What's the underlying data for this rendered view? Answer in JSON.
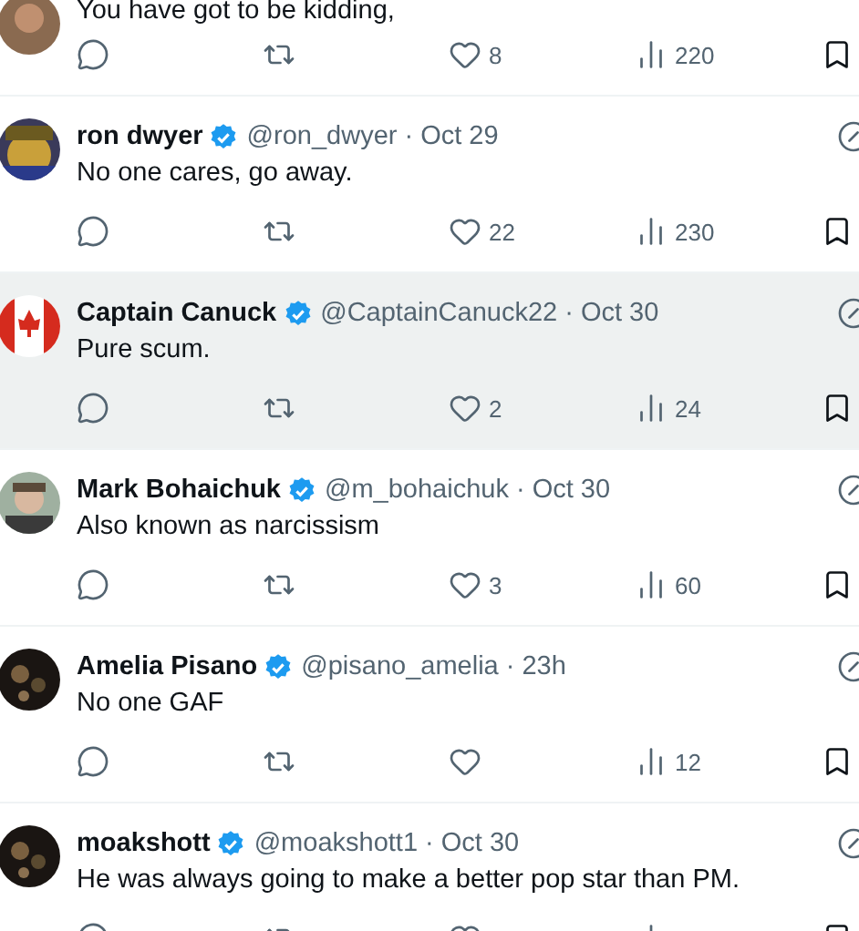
{
  "tweets": [
    {
      "text": "You have got to be kidding,",
      "highlighted": false,
      "likes": "8",
      "views": "220"
    },
    {
      "name": "ron dwyer",
      "handle": "@ron_dwyer",
      "separator": "·",
      "time": "Oct 29",
      "text": "No one cares, go away.",
      "highlighted": false,
      "likes": "22",
      "views": "230"
    },
    {
      "name": "Captain Canuck",
      "handle": "@CaptainCanuck22",
      "separator": "·",
      "time": "Oct 30",
      "text": "Pure scum.",
      "highlighted": true,
      "likes": "2",
      "views": "24"
    },
    {
      "name": "Mark Bohaichuk",
      "handle": "@m_bohaichuk",
      "separator": "·",
      "time": "Oct 30",
      "text": "Also known as narcissism",
      "highlighted": false,
      "likes": "3",
      "views": "60"
    },
    {
      "name": "Amelia Pisano",
      "handle": "@pisano_amelia",
      "separator": "·",
      "time": "23h",
      "text": "No one GAF",
      "highlighted": false,
      "views": "12"
    },
    {
      "name": "moakshott",
      "handle": "@moakshott1",
      "separator": "·",
      "time": "Oct 30",
      "text": "He was always going to make a better pop star than PM.",
      "highlighted": false
    }
  ]
}
